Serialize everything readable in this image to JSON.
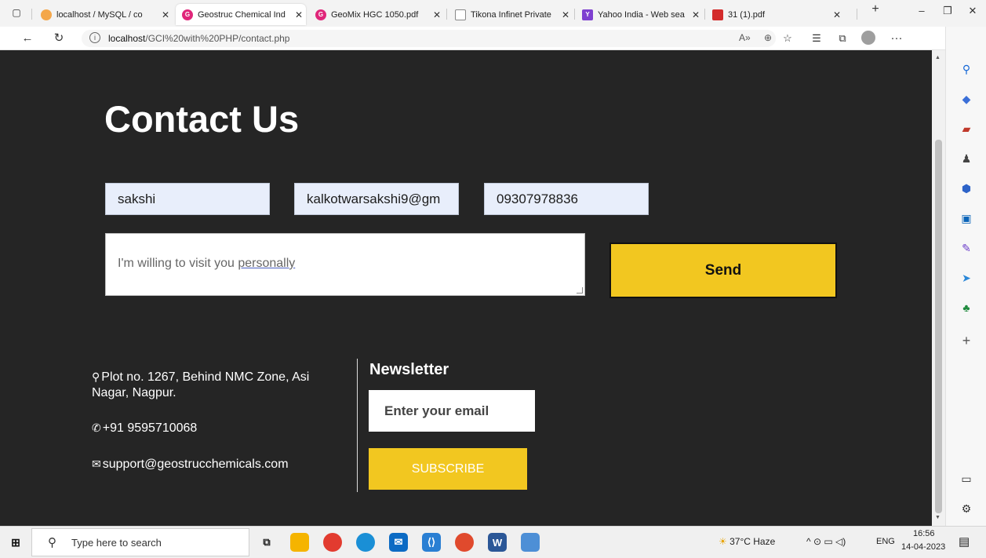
{
  "browser": {
    "tabs": [
      {
        "title": "localhost / MySQL / co",
        "active": false,
        "icon": "phpmyadmin-icon"
      },
      {
        "title": "Geostruc Chemical Ind",
        "active": true,
        "icon": "site-icon"
      },
      {
        "title": "GeoMix HGC 1050.pdf",
        "active": false,
        "icon": "site-icon"
      },
      {
        "title": "Tikona Infinet Private",
        "active": false,
        "icon": "page-icon"
      },
      {
        "title": "Yahoo India - Web sea",
        "active": false,
        "icon": "yahoo-icon"
      },
      {
        "title": "31 (1).pdf",
        "active": false,
        "icon": "pdf-icon"
      }
    ],
    "url_host": "localhost",
    "url_path": "/GCI%20with%20PHP/contact.php"
  },
  "page": {
    "heading": "Contact Us",
    "form": {
      "name_value": "sakshi",
      "email_value": "kalkotwarsakshi9@gm",
      "phone_value": "09307978836",
      "message_part1": "I'm willing to visit you ",
      "message_part2": "personally",
      "send_label": "Send"
    },
    "contact": {
      "address": "Plot no. 1267, Behind NMC Zone, Asi Nagar, Nagpur.",
      "phone": "+91 9595710068",
      "email": "support@geostrucchemicals.com"
    },
    "newsletter": {
      "title": "Newsletter",
      "email_placeholder": "Enter your email",
      "subscribe_label": "SUBSCRIBE"
    }
  },
  "taskbar": {
    "search_placeholder": "Type here to search",
    "weather": "37°C  Haze",
    "language": "ENG",
    "time": "16:56",
    "date": "14-04-2023"
  },
  "colors": {
    "page_bg": "#252525",
    "accent_yellow": "#f2c720",
    "input_bg": "#e8eefb"
  }
}
